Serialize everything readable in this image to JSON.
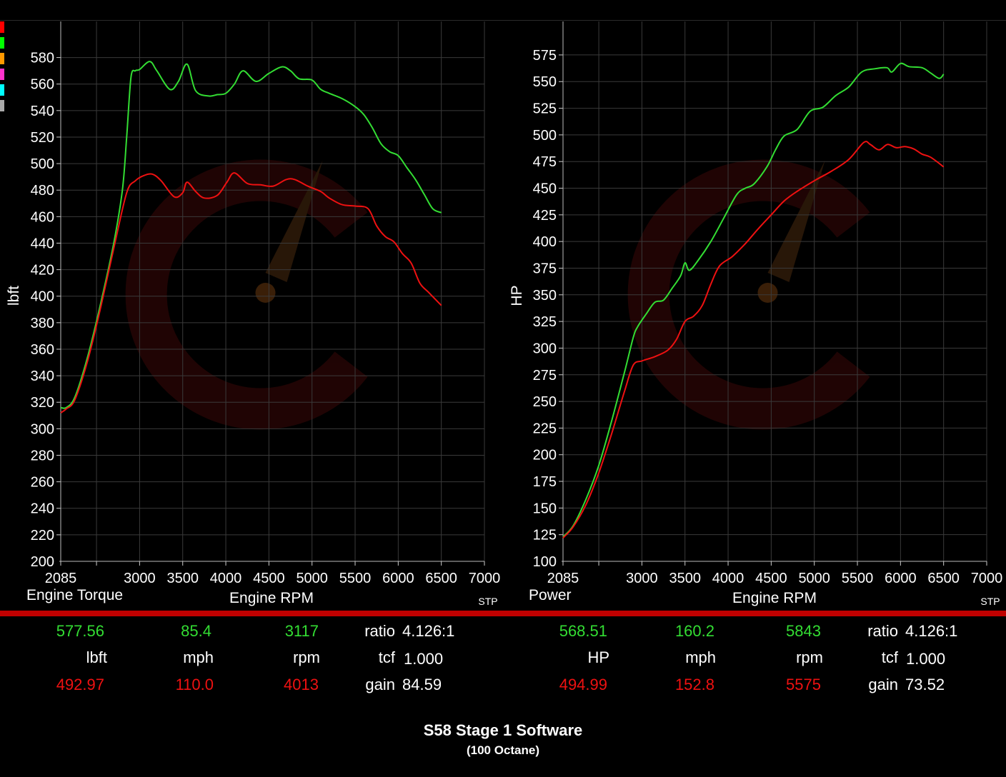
{
  "legend_swatch_colors": [
    "#ff0000",
    "#00ff00",
    "#ff9900",
    "#ff33cc",
    "#00ffff",
    "#aaaaaa"
  ],
  "colors": {
    "after": "#33dd33",
    "before": "#ee1111",
    "watermark": "#8b1010"
  },
  "chart_data": [
    {
      "type": "line",
      "title": "Engine Torque",
      "xlabel": "Engine RPM",
      "ylabel": "lbft",
      "corner_label": "STP",
      "xlim": [
        2085,
        7000
      ],
      "ylim": [
        200,
        590
      ],
      "x_ticks": [
        2085,
        3000,
        3500,
        4000,
        4500,
        5000,
        5500,
        6000,
        6500,
        7000
      ],
      "y_ticks": [
        200,
        220,
        240,
        260,
        280,
        300,
        320,
        340,
        360,
        380,
        400,
        420,
        440,
        460,
        480,
        500,
        520,
        540,
        560,
        580
      ],
      "grid": true,
      "series": [
        {
          "color": "green",
          "points": [
            [
              2085,
              316
            ],
            [
              2150,
              316
            ],
            [
              2250,
              324
            ],
            [
              2400,
              355
            ],
            [
              2550,
              395
            ],
            [
              2700,
              440
            ],
            [
              2800,
              480
            ],
            [
              2850,
              520
            ],
            [
              2900,
              565
            ],
            [
              2950,
              570
            ],
            [
              3000,
              571
            ],
            [
              3117,
              577
            ],
            [
              3200,
              570
            ],
            [
              3350,
              556
            ],
            [
              3450,
              562
            ],
            [
              3550,
              575
            ],
            [
              3650,
              555
            ],
            [
              3800,
              551
            ],
            [
              3900,
              552
            ],
            [
              4000,
              553
            ],
            [
              4100,
              560
            ],
            [
              4200,
              570
            ],
            [
              4350,
              562
            ],
            [
              4500,
              568
            ],
            [
              4650,
              573
            ],
            [
              4750,
              570
            ],
            [
              4850,
              564
            ],
            [
              5000,
              563
            ],
            [
              5100,
              556
            ],
            [
              5200,
              553
            ],
            [
              5350,
              549
            ],
            [
              5500,
              543
            ],
            [
              5600,
              537
            ],
            [
              5700,
              527
            ],
            [
              5800,
              515
            ],
            [
              5900,
              509
            ],
            [
              6000,
              506
            ],
            [
              6100,
              497
            ],
            [
              6200,
              488
            ],
            [
              6300,
              477
            ],
            [
              6400,
              466
            ],
            [
              6500,
              463
            ]
          ]
        },
        {
          "color": "red",
          "points": [
            [
              2085,
              312
            ],
            [
              2150,
              315
            ],
            [
              2250,
              322
            ],
            [
              2400,
              352
            ],
            [
              2550,
              392
            ],
            [
              2700,
              436
            ],
            [
              2850,
              478
            ],
            [
              2950,
              487
            ],
            [
              3050,
              491
            ],
            [
              3150,
              492
            ],
            [
              3250,
              487
            ],
            [
              3400,
              475
            ],
            [
              3500,
              478
            ],
            [
              3550,
              486
            ],
            [
              3650,
              479
            ],
            [
              3750,
              474
            ],
            [
              3900,
              476
            ],
            [
              4013,
              486
            ],
            [
              4100,
              493
            ],
            [
              4250,
              485
            ],
            [
              4400,
              484
            ],
            [
              4550,
              483
            ],
            [
              4700,
              488
            ],
            [
              4800,
              488
            ],
            [
              4950,
              483
            ],
            [
              5100,
              479
            ],
            [
              5200,
              474
            ],
            [
              5350,
              469
            ],
            [
              5500,
              468
            ],
            [
              5650,
              466
            ],
            [
              5750,
              453
            ],
            [
              5850,
              445
            ],
            [
              5950,
              441
            ],
            [
              6050,
              432
            ],
            [
              6150,
              425
            ],
            [
              6250,
              410
            ],
            [
              6350,
              403
            ],
            [
              6500,
              393
            ]
          ]
        }
      ]
    },
    {
      "type": "line",
      "title": "Power",
      "xlabel": "Engine RPM",
      "ylabel": "HP",
      "corner_label": "STP",
      "xlim": [
        2085,
        7000
      ],
      "ylim": [
        100,
        585
      ],
      "x_ticks": [
        2085,
        3000,
        3500,
        4000,
        4500,
        5000,
        5500,
        6000,
        6500,
        7000
      ],
      "y_ticks": [
        100,
        125,
        150,
        175,
        200,
        225,
        250,
        275,
        300,
        325,
        350,
        375,
        400,
        425,
        450,
        475,
        500,
        525,
        550,
        575
      ],
      "grid": true,
      "series": [
        {
          "color": "green",
          "points": [
            [
              2085,
              123
            ],
            [
              2200,
              133
            ],
            [
              2350,
              158
            ],
            [
              2500,
              190
            ],
            [
              2650,
              232
            ],
            [
              2800,
              278
            ],
            [
              2900,
              310
            ],
            [
              2950,
              320
            ],
            [
              3050,
              332
            ],
            [
              3150,
              343
            ],
            [
              3250,
              345
            ],
            [
              3350,
              356
            ],
            [
              3450,
              368
            ],
            [
              3500,
              380
            ],
            [
              3550,
              373
            ],
            [
              3650,
              382
            ],
            [
              3800,
              400
            ],
            [
              3950,
              422
            ],
            [
              4100,
              444
            ],
            [
              4200,
              450
            ],
            [
              4300,
              454
            ],
            [
              4450,
              470
            ],
            [
              4550,
              486
            ],
            [
              4650,
              499
            ],
            [
              4800,
              505
            ],
            [
              4950,
              522
            ],
            [
              5100,
              526
            ],
            [
              5250,
              537
            ],
            [
              5400,
              545
            ],
            [
              5550,
              559
            ],
            [
              5700,
              562
            ],
            [
              5843,
              563
            ],
            [
              5900,
              559
            ],
            [
              6000,
              567
            ],
            [
              6100,
              564
            ],
            [
              6250,
              563
            ],
            [
              6350,
              558
            ],
            [
              6450,
              553
            ],
            [
              6500,
              557
            ]
          ]
        },
        {
          "color": "red",
          "points": [
            [
              2085,
              122
            ],
            [
              2200,
              132
            ],
            [
              2350,
              153
            ],
            [
              2500,
              183
            ],
            [
              2650,
              220
            ],
            [
              2800,
              260
            ],
            [
              2900,
              284
            ],
            [
              3000,
              288
            ],
            [
              3150,
              292
            ],
            [
              3300,
              298
            ],
            [
              3400,
              308
            ],
            [
              3500,
              325
            ],
            [
              3600,
              330
            ],
            [
              3700,
              340
            ],
            [
              3800,
              360
            ],
            [
              3900,
              377
            ],
            [
              4050,
              386
            ],
            [
              4200,
              398
            ],
            [
              4350,
              412
            ],
            [
              4500,
              425
            ],
            [
              4650,
              438
            ],
            [
              4800,
              447
            ],
            [
              5000,
              457
            ],
            [
              5200,
              466
            ],
            [
              5400,
              477
            ],
            [
              5575,
              493
            ],
            [
              5650,
              491
            ],
            [
              5750,
              486
            ],
            [
              5850,
              491
            ],
            [
              5950,
              488
            ],
            [
              6050,
              489
            ],
            [
              6150,
              487
            ],
            [
              6250,
              482
            ],
            [
              6350,
              479
            ],
            [
              6500,
              470
            ]
          ]
        }
      ]
    }
  ],
  "readouts": {
    "left": {
      "green_value": "577.56",
      "green_speed": "85.4",
      "green_rpm": "3117",
      "unit_value": "lbft",
      "unit_speed": "mph",
      "unit_rpm": "rpm",
      "red_value": "492.97",
      "red_speed": "110.0",
      "red_rpm": "4013",
      "ratio_label": "ratio",
      "ratio_value": "4.126:1",
      "tcf_label": "tcf",
      "tcf_value": "1.000",
      "gain_label": "gain",
      "gain_value": "84.59"
    },
    "right": {
      "green_value": "568.51",
      "green_speed": "160.2",
      "green_rpm": "5843",
      "unit_value": "HP",
      "unit_speed": "mph",
      "unit_rpm": "rpm",
      "red_value": "494.99",
      "red_speed": "152.8",
      "red_rpm": "5575",
      "ratio_label": "ratio",
      "ratio_value": "4.126:1",
      "tcf_label": "tcf",
      "tcf_value": "1.000",
      "gain_label": "gain",
      "gain_value": "73.52"
    }
  },
  "run_title": "S58 Stage 1 Software",
  "run_subtitle": "(100 Octane)"
}
